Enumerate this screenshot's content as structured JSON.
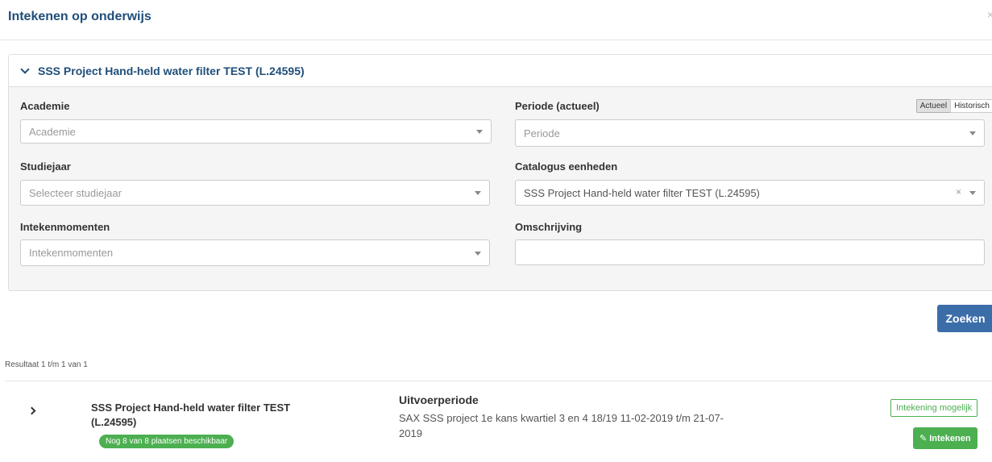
{
  "modal": {
    "title": "Intekenen op onderwijs",
    "close_glyph": "×"
  },
  "filters": {
    "header": "SSS Project Hand-held water filter TEST (L.24595)",
    "academie": {
      "label": "Academie",
      "placeholder": "Academie"
    },
    "periode": {
      "label": "Periode (actueel)",
      "placeholder": "Periode",
      "toggle": {
        "actueel": "Actueel",
        "historisch": "Historisch",
        "active": "Actueel"
      }
    },
    "studiejaar": {
      "label": "Studiejaar",
      "placeholder": "Selecteer studiejaar"
    },
    "catalogus": {
      "label": "Catalogus eenheden",
      "value": "SSS Project Hand-held water filter TEST (L.24595)",
      "clear_glyph": "×"
    },
    "intekenmomenten": {
      "label": "Intekenmomenten",
      "placeholder": "Intekenmomenten"
    },
    "omschrijving": {
      "label": "Omschrijving",
      "value": ""
    }
  },
  "search_button": "Zoeken",
  "results": {
    "count_text": "Resultaat 1 t/m 1 van 1",
    "items": [
      {
        "title": "SSS Project Hand-held water filter TEST (L.24595)",
        "availability": "Nog 8 van 8 plaatsen beschikbaar",
        "period_label": "Uitvoerperiode",
        "period_text": "SAX SSS project 1e kans kwartiel 3 en 4 18/19 11-02-2019 t/m 21-07-2019",
        "status": "Intekening mogelijk",
        "action": "Intekenen"
      }
    ]
  },
  "icons": {
    "panel_toggle": "chevron-down-icon",
    "row_expand": "chevron-right-icon",
    "action": "pencil-icon"
  },
  "colors": {
    "title": "#1f4e79",
    "primary_button": "#3b6da8",
    "success": "#4caf50"
  }
}
